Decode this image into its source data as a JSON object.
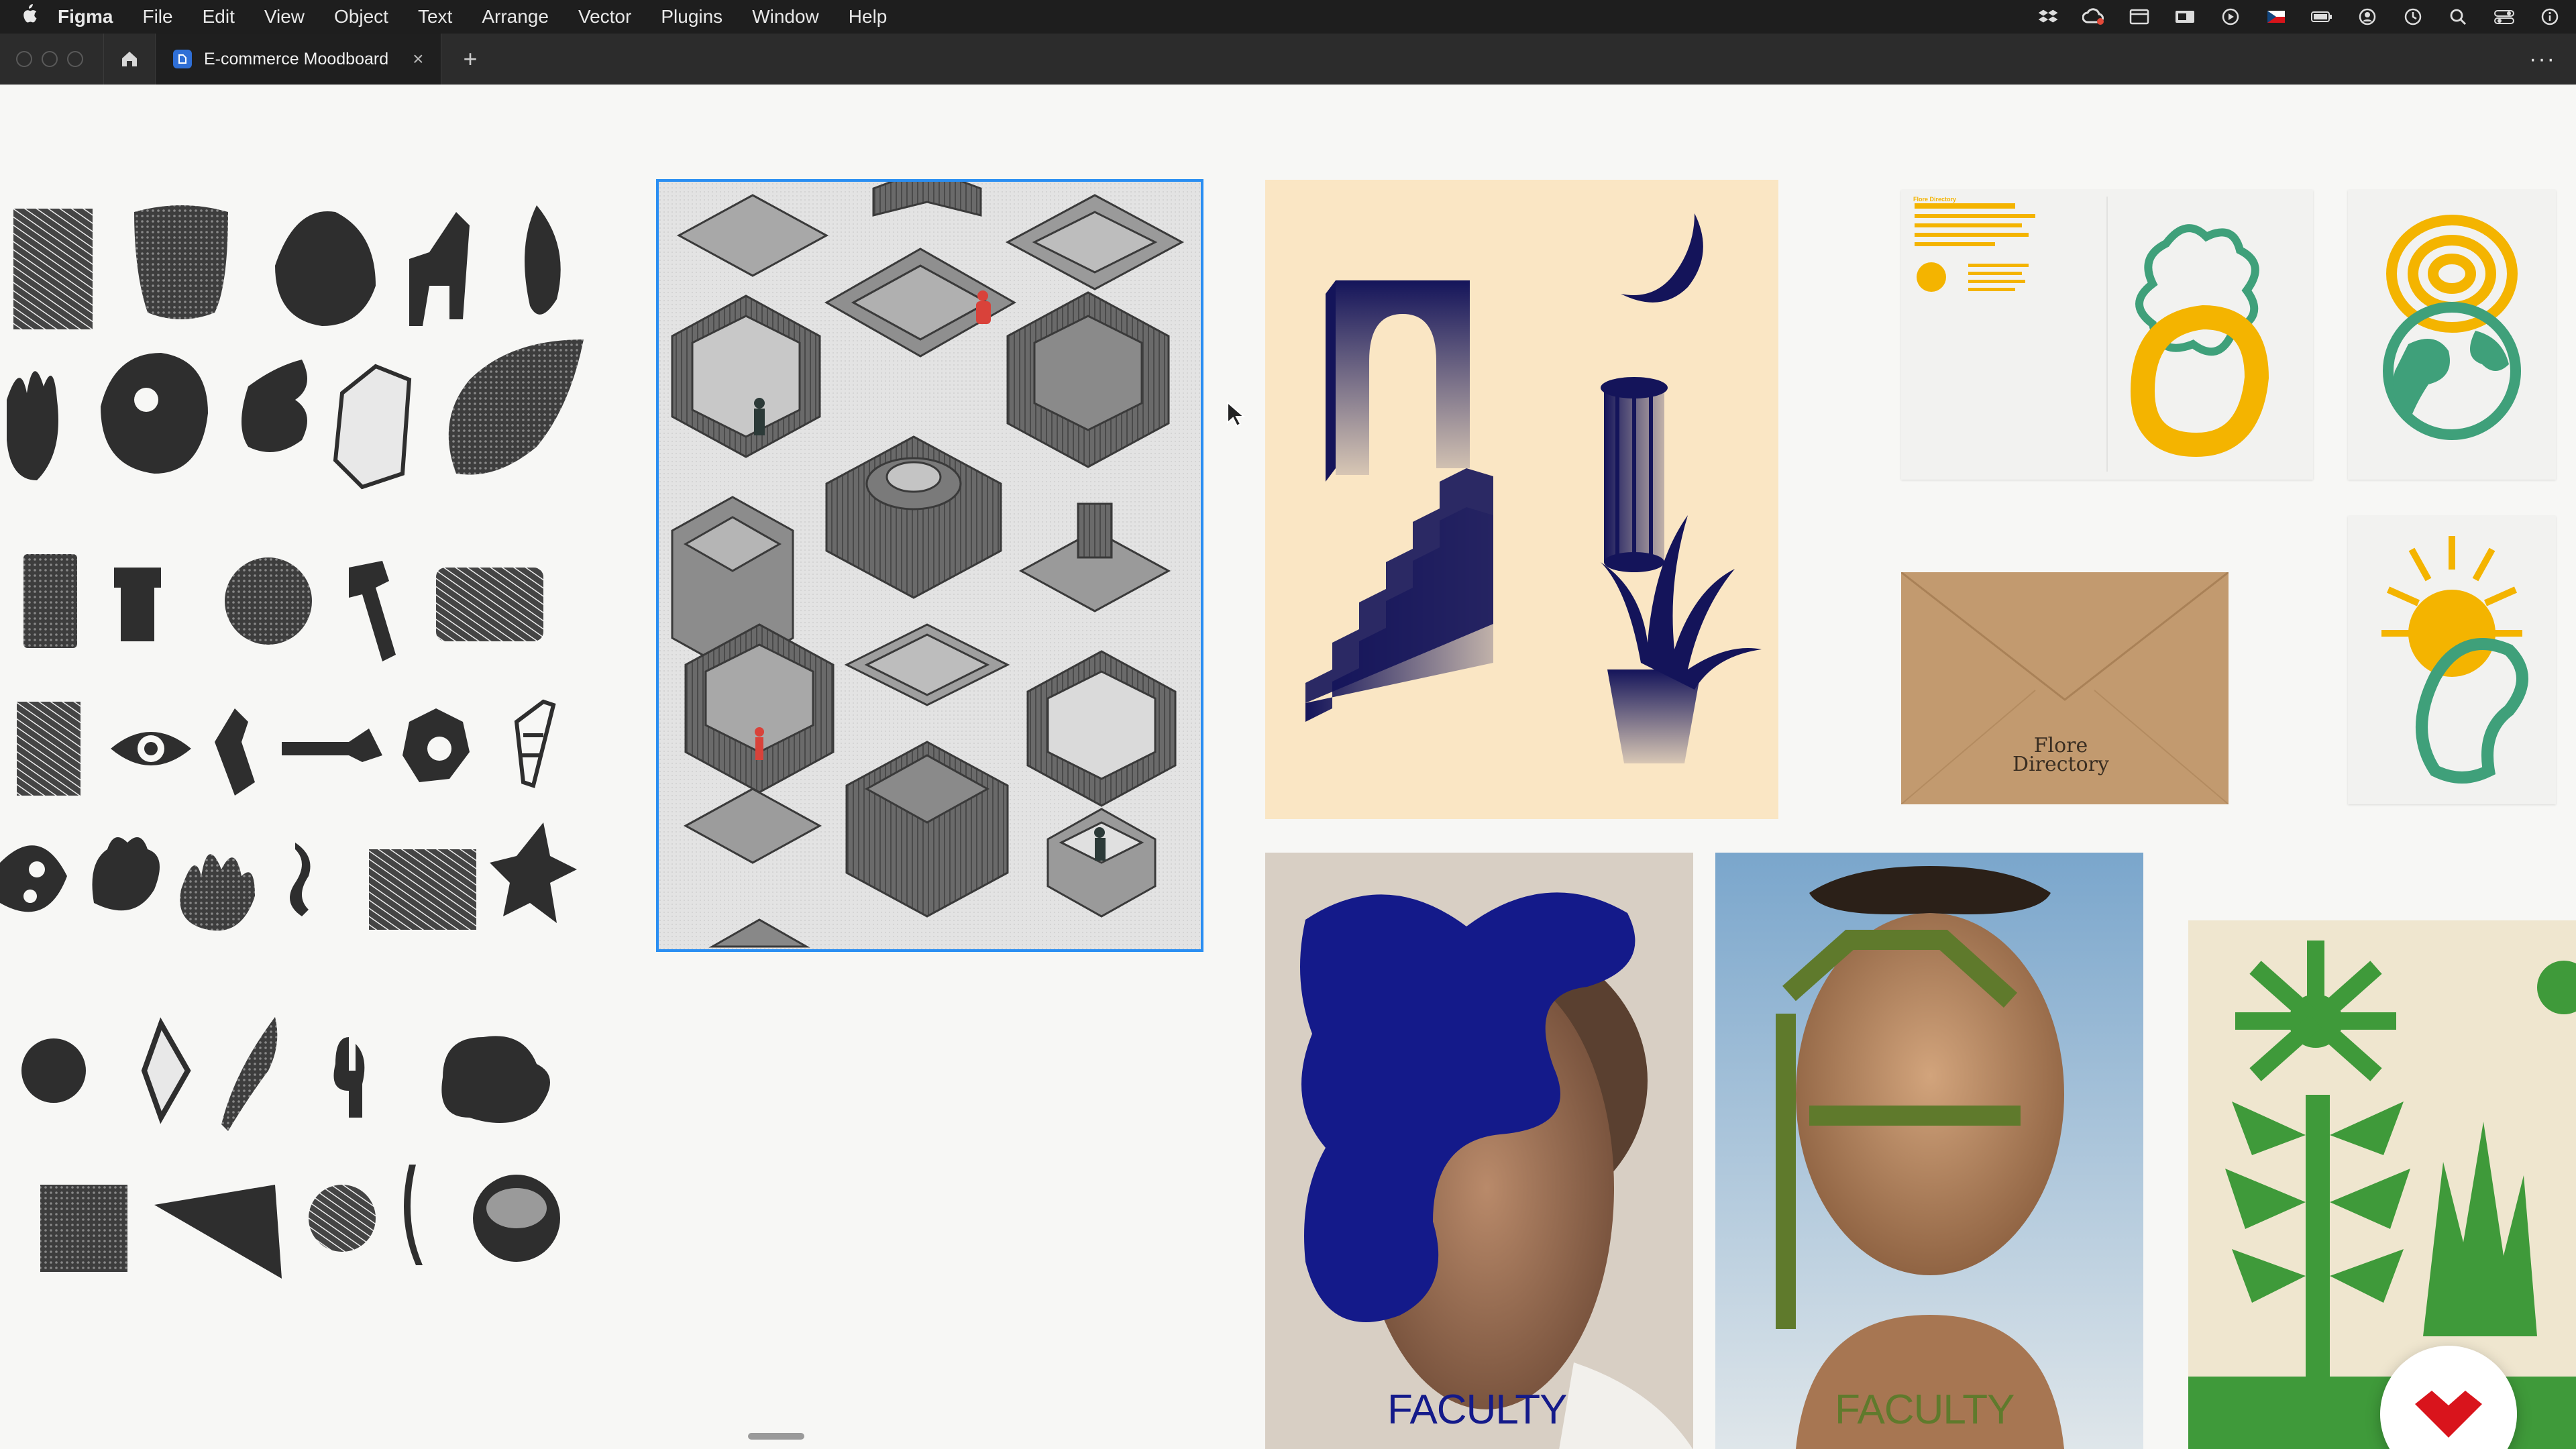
{
  "menubar": {
    "app_name": "Figma",
    "items": [
      "File",
      "Edit",
      "View",
      "Object",
      "Text",
      "Arrange",
      "Vector",
      "Plugins",
      "Window",
      "Help"
    ],
    "tray_icons": [
      "dropbox-icon",
      "creative-cloud-icon",
      "window-icon",
      "display-icon",
      "play-icon",
      "flag-icon",
      "battery-icon",
      "user-icon",
      "clock-icon",
      "search-icon",
      "control-center-icon",
      "info-icon"
    ]
  },
  "tabbar": {
    "tab_title": "E-commerce Moodboard",
    "close_glyph": "×",
    "add_glyph": "+",
    "more_glyph": "···"
  },
  "canvas": {
    "envelope_label_line1": "Flore",
    "envelope_label_line2": "Directory",
    "poster_caption_1": "FACULTY",
    "poster_caption_2": "FACULTY",
    "poster_paper_heading": "Flore Directory",
    "colors": {
      "selection": "#2a8ef2",
      "navy": "#14145a",
      "cream": "#fae6c4",
      "olive": "#5f7a2c",
      "green": "#3f9a3a",
      "yellow": "#f4b400",
      "teal": "#3fa07a",
      "kraft": "#c29a6f"
    }
  }
}
